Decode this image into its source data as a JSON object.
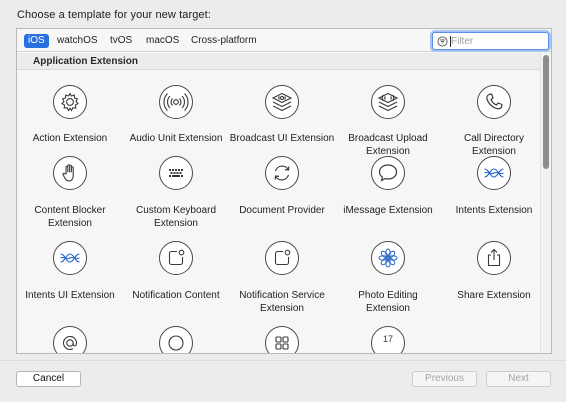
{
  "prompt": "Choose a template for your new target:",
  "tabs": [
    {
      "label": "iOS",
      "selected": true
    },
    {
      "label": "watchOS",
      "selected": false
    },
    {
      "label": "tvOS",
      "selected": false
    },
    {
      "label": "macOS",
      "selected": false
    },
    {
      "label": "Cross-platform",
      "selected": false
    }
  ],
  "filter": {
    "placeholder": "Filter",
    "value": ""
  },
  "section": {
    "title": "Application Extension"
  },
  "templates": [
    {
      "label": "Action Extension",
      "icon": "gear-icon"
    },
    {
      "label": "Audio Unit Extension",
      "icon": "audio-waves-icon"
    },
    {
      "label": "Broadcast UI Extension",
      "icon": "broadcast-stack-icon"
    },
    {
      "label": "Broadcast Upload Extension",
      "icon": "broadcast-upload-icon"
    },
    {
      "label": "Call Directory Extension",
      "icon": "phone-icon"
    },
    {
      "label": "Content Blocker Extension",
      "icon": "hand-icon"
    },
    {
      "label": "Custom Keyboard Extension",
      "icon": "keyboard-icon"
    },
    {
      "label": "Document Provider",
      "icon": "refresh-arrows-icon"
    },
    {
      "label": "iMessage Extension",
      "icon": "speech-bubble-icon"
    },
    {
      "label": "Intents Extension",
      "icon": "intents-waves-icon"
    },
    {
      "label": "Intents UI Extension",
      "icon": "intents-ui-waves-icon"
    },
    {
      "label": "Notification Content",
      "icon": "notification-icon"
    },
    {
      "label": "Notification Service Extension",
      "icon": "notification-service-icon"
    },
    {
      "label": "Photo Editing Extension",
      "icon": "photo-flower-icon"
    },
    {
      "label": "Share Extension",
      "icon": "share-icon"
    },
    {
      "label": "",
      "icon": "at-sign-icon"
    },
    {
      "label": "",
      "icon": "circle-icon"
    },
    {
      "label": "",
      "icon": "grid-icon"
    },
    {
      "label": "",
      "icon": "calendar-icon",
      "badge": "17"
    }
  ],
  "buttons": {
    "cancel": "Cancel",
    "previous": "Previous",
    "next": "Next"
  }
}
